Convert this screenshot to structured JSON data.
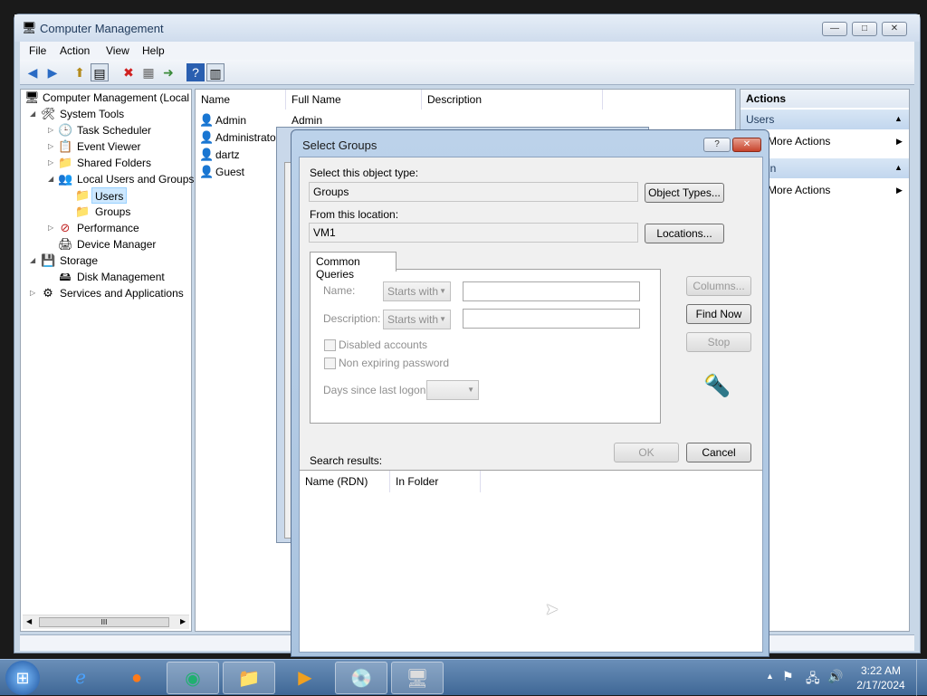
{
  "window": {
    "title": "Computer Management",
    "minimize": "—",
    "maximize": "□",
    "close": "✕"
  },
  "menu": [
    "File",
    "Action",
    "View",
    "Help"
  ],
  "tree": {
    "root": "Computer Management (Local",
    "system_tools": "System Tools",
    "task_scheduler": "Task Scheduler",
    "event_viewer": "Event Viewer",
    "shared_folders": "Shared Folders",
    "local_users_groups": "Local Users and Groups",
    "users": "Users",
    "groups": "Groups",
    "performance": "Performance",
    "device_manager": "Device Manager",
    "storage": "Storage",
    "disk_management": "Disk Management",
    "services_apps": "Services and Applications",
    "scroll_thumb": "III"
  },
  "list": {
    "columns": [
      "Name",
      "Full Name",
      "Description"
    ],
    "rows": [
      {
        "name": "Admin",
        "full_name": "Admin"
      },
      {
        "name": "Administrato",
        "full_name": ""
      },
      {
        "name": "dartz",
        "full_name": ""
      },
      {
        "name": "Guest",
        "full_name": ""
      }
    ]
  },
  "actions": {
    "header": "Actions",
    "section1": "Users",
    "more_actions_1": "More Actions",
    "section2": "in",
    "more_actions_2": "More Actions"
  },
  "dialog": {
    "title": "Select Groups",
    "help_btn": "?",
    "close_btn": "✕",
    "object_type_label": "Select this object type:",
    "object_type_value": "Groups",
    "object_types_btn": "Object Types...",
    "location_label": "From this location:",
    "location_value": "VM1",
    "locations_btn": "Locations...",
    "tab": "Common Queries",
    "name_label": "Name:",
    "name_mode": "Starts with",
    "desc_label": "Description:",
    "desc_mode": "Starts with",
    "disabled_accounts": "Disabled accounts",
    "non_expiring": "Non expiring password",
    "days_since": "Days since last logon:",
    "columns_btn": "Columns...",
    "find_now_btn": "Find Now",
    "stop_btn": "Stop",
    "ok_btn": "OK",
    "cancel_btn": "Cancel",
    "search_results": "Search results:",
    "results_columns": [
      "Name (RDN)",
      "In Folder"
    ]
  },
  "taskbar": {
    "time": "3:22 AM",
    "date": "2/17/2024"
  }
}
